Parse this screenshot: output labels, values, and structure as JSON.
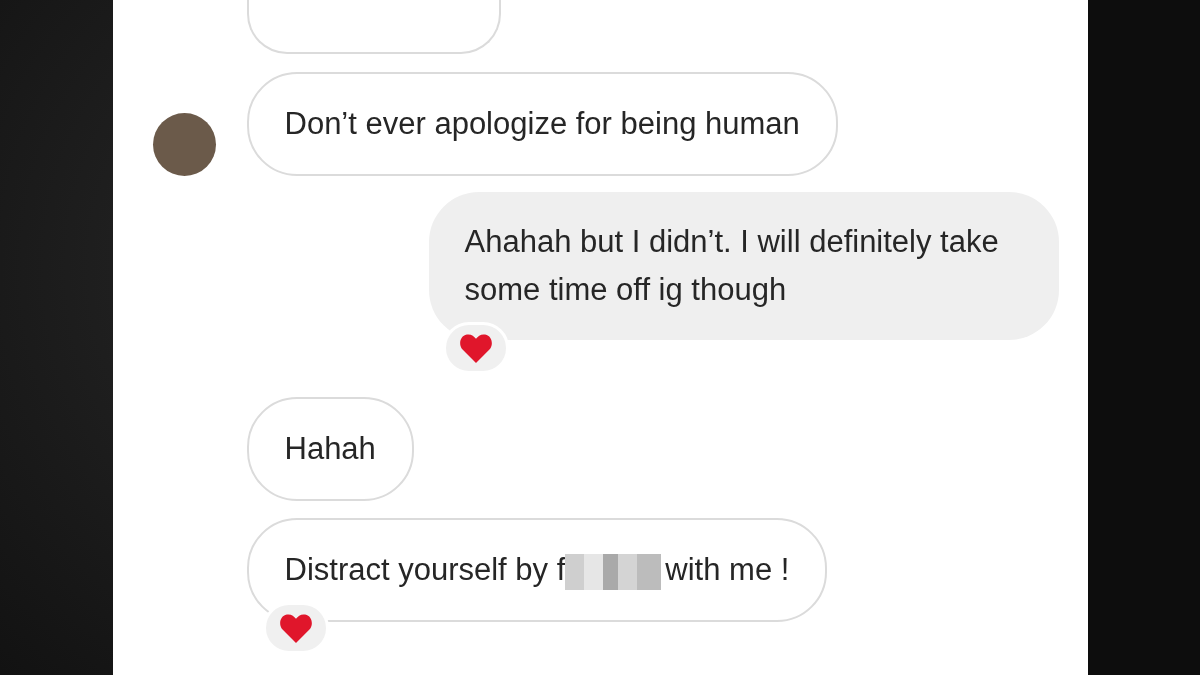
{
  "messages": [
    {
      "kind": "clipped",
      "avatar": false,
      "reacted": false
    },
    {
      "kind": "received",
      "avatar": true,
      "reacted": false,
      "parts": [
        {
          "kind": "text",
          "text": "Don’t ever apologize for being human"
        }
      ]
    },
    {
      "kind": "sent",
      "avatar": false,
      "reacted": true,
      "parts": [
        {
          "kind": "text",
          "text": "Ahahah but I didn’t. I will definitely take some time off ig though"
        }
      ]
    },
    {
      "kind": "received",
      "avatar": false,
      "reacted": false,
      "parts": [
        {
          "kind": "text",
          "text": "Hahah"
        }
      ]
    },
    {
      "kind": "received",
      "avatar": false,
      "reacted": true,
      "parts": [
        {
          "kind": "text",
          "text": "Distract yourself by f"
        },
        {
          "kind": "censored"
        },
        {
          "kind": "text",
          "text": "with me !"
        }
      ]
    }
  ]
}
